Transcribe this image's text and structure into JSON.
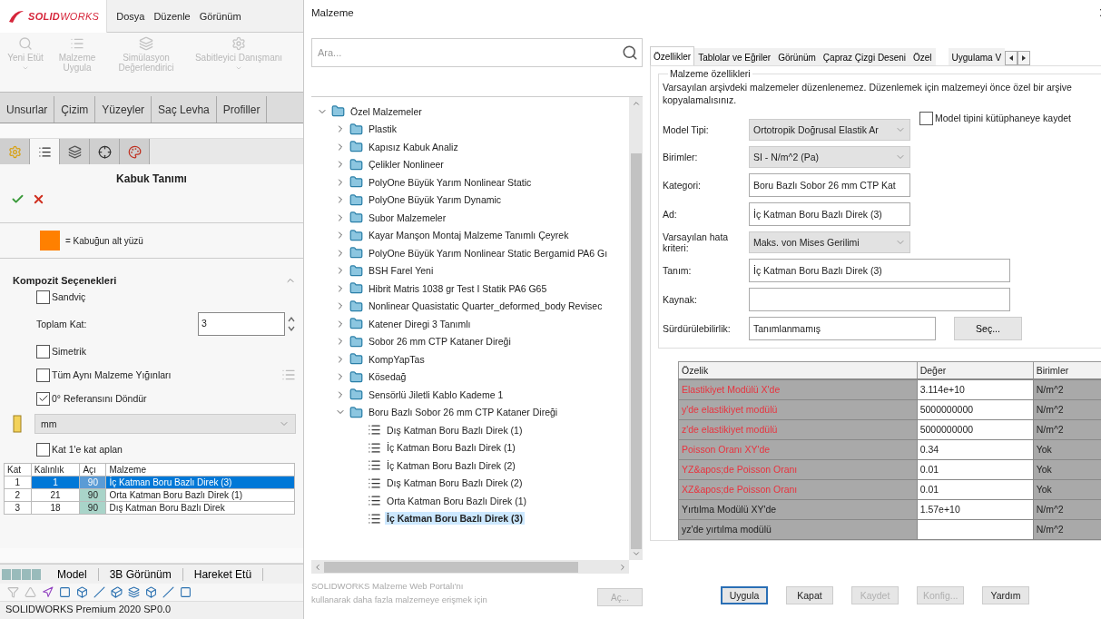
{
  "app": {
    "logo_text": "**SOLID**WORKS",
    "menu": [
      "Dosya",
      "Düzenle",
      "Görünüm"
    ],
    "ribbon": [
      {
        "label": "Yeni Etüt",
        "caret": true
      },
      {
        "label": "Malzeme Uygula",
        "caret": false
      },
      {
        "label": "Simülasyon Değerlendirici",
        "caret": false
      },
      {
        "label": "Sabitleyici Danışmanı",
        "caret": true
      }
    ],
    "command_tabs": [
      {
        "label": "Unsurlar",
        "selected": false
      },
      {
        "label": "Çizim",
        "selected": false
      },
      {
        "label": "Yüzeyler",
        "selected": false
      },
      {
        "label": "Saç Levha",
        "selected": false
      },
      {
        "label": "Profiller",
        "selected": false
      }
    ],
    "manager_tabs": [
      {
        "selected": false
      },
      {
        "selected": true
      },
      {
        "selected": false
      },
      {
        "selected": false
      },
      {
        "selected": false
      }
    ],
    "property_manager": {
      "title": "Kabuk Tanımı",
      "legend": "= Kabuğun alt yüzü",
      "section": {
        "title": "Kompozit Seçenekleri",
        "expanded": true,
        "options": [
          {
            "kind": "checkbox",
            "label": "Sandviç",
            "checked": false
          },
          {
            "kind": "spin",
            "label": "Toplam Kat:",
            "value": "3"
          },
          {
            "kind": "checkbox",
            "label": "Simetrik",
            "checked": false
          },
          {
            "kind": "checkbox",
            "label": "Tüm Aynı Malzeme Yığınları",
            "checked": false,
            "side_icon": true
          },
          {
            "kind": "checkbox",
            "label": "0° Referansını Döndür",
            "checked": true
          },
          {
            "kind": "select",
            "value": "mm"
          },
          {
            "kind": "checkbox",
            "label": "Kat 1'e kat aplan",
            "checked": false
          }
        ],
        "layers": {
          "columns": [
            "Kat",
            "Kalınlık",
            "Açı",
            "Malzeme"
          ],
          "rows": [
            {
              "cells": [
                "1",
                "1",
                "90",
                "İç Katman Boru Bazlı Direk (3)"
              ],
              "selected": true
            },
            {
              "cells": [
                "2",
                "21",
                "90",
                "Orta Katman Boru Bazlı Direk (1)"
              ],
              "selected": false
            },
            {
              "cells": [
                "3",
                "18",
                "90",
                "Dış Katman Boru Bazlı Direk"
              ],
              "selected": false
            }
          ]
        }
      }
    },
    "bottom_tabs": [
      "Model",
      "3B Görünüm",
      "Hareket Etü"
    ],
    "status_bar": "SOLIDWORKS Premium 2020 SP0.0"
  },
  "dialog": {
    "title": "Malzeme",
    "search": {
      "placeholder": "Ara..."
    },
    "tree": [
      {
        "kind": "folder",
        "label": "Özel Malzemeler",
        "expanded": true,
        "selected": false,
        "children": [
          {
            "kind": "folder",
            "label": "Plastik",
            "expanded": false,
            "selected": false
          },
          {
            "kind": "folder",
            "label": "Kapısız Kabuk Analiz",
            "expanded": false,
            "selected": false
          },
          {
            "kind": "folder",
            "label": "Çelikler Nonlineer",
            "expanded": false,
            "selected": false
          },
          {
            "kind": "folder",
            "label": "PolyOne Büyük Yarım Nonlinear Static",
            "expanded": false,
            "selected": false
          },
          {
            "kind": "folder",
            "label": "PolyOne Büyük Yarım Dynamic",
            "expanded": false,
            "selected": false
          },
          {
            "kind": "folder",
            "label": "Subor Malzemeler",
            "expanded": false,
            "selected": false
          },
          {
            "kind": "folder",
            "label": "Kayar Manşon Montaj Malzeme Tanımlı Çeyrek",
            "expanded": false,
            "selected": false
          },
          {
            "kind": "folder",
            "label": "PolyOne Büyük Yarım Nonlinear Static Bergamid PA6 Gı",
            "expanded": false,
            "selected": false
          },
          {
            "kind": "folder",
            "label": "BSH Farel Yeni",
            "expanded": false,
            "selected": false
          },
          {
            "kind": "folder",
            "label": "Hibrit Matris 1038 gr Test I Statik PA6 G65",
            "expanded": false,
            "selected": false
          },
          {
            "kind": "folder",
            "label": "Nonlinear Quasistatic Quarter_deformed_body Revisec",
            "expanded": false,
            "selected": false
          },
          {
            "kind": "folder",
            "label": "Katener Diregi 3 Tanımlı",
            "expanded": false,
            "selected": false
          },
          {
            "kind": "folder",
            "label": "Sobor 26 mm CTP Kataner Direği",
            "expanded": false,
            "selected": false
          },
          {
            "kind": "folder",
            "label": "KompYapTas",
            "expanded": false,
            "selected": false
          },
          {
            "kind": "folder",
            "label": "Kösedağ",
            "expanded": false,
            "selected": false
          },
          {
            "kind": "folder",
            "label": "Sensörlü Jiletli Kablo Kademe 1",
            "expanded": false,
            "selected": false
          },
          {
            "kind": "folder",
            "label": "Boru Bazlı Sobor 26 mm CTP Kataner Direği",
            "expanded": true,
            "selected": false,
            "children": [
              {
                "kind": "material",
                "label": "Dış Katman Boru Bazlı Direk (1)",
                "selected": false
              },
              {
                "kind": "material",
                "label": "İç Katman Boru Bazlı Direk (1)",
                "selected": false
              },
              {
                "kind": "material",
                "label": "İç Katman Boru Bazlı Direk (2)",
                "selected": false
              },
              {
                "kind": "material",
                "label": "Dış Katman Boru Bazlı Direk (2)",
                "selected": false
              },
              {
                "kind": "material",
                "label": "Orta Katman Boru Bazlı Direk (1)",
                "selected": false
              },
              {
                "kind": "material",
                "label": "İç Katman Boru Bazlı Direk (3)",
                "selected": true
              }
            ]
          }
        ]
      }
    ],
    "portal_text": "SOLIDWORKS Malzeme Web Portalı'nı kullanarak daha fazla malzemeye erişmek için",
    "open_button": {
      "label": "Aç...",
      "disabled": true
    },
    "tabs": [
      {
        "label": "Özellikler",
        "selected": true
      },
      {
        "label": "Tablolar ve Eğriler",
        "selected": false
      },
      {
        "label": "Görünüm",
        "selected": false
      },
      {
        "label": "Çapraz Çizgi Deseni",
        "selected": false
      },
      {
        "label": "Özel",
        "selected": false
      },
      {
        "label": "Uygulama V",
        "selected": false
      }
    ],
    "group_title": "Malzeme özellikleri",
    "note": "Varsayılan arşivdeki malzemeler düzenlenemez. Düzenlemek için malzemeyi önce özel bir arşive kopyalamalısınız.",
    "save_model_type": {
      "label": "Model tipini kütüphaneye kaydet",
      "checked": false
    },
    "fields": [
      {
        "kind": "select",
        "label": "Model Tipi:",
        "value": "Ortotropik Doğrusal Elastik Ar"
      },
      {
        "kind": "select",
        "label": "Birimler:",
        "value": "SI - N/m^2 (Pa)"
      },
      {
        "kind": "input",
        "label": "Kategori:",
        "value": "Boru Bazlı Sobor 26 mm CTP Kat"
      },
      {
        "kind": "input",
        "label": "Ad:",
        "value": "İç Katman Boru Bazlı Direk (3)"
      },
      {
        "kind": "select",
        "label": "Varsayılan hata kriteri:",
        "value": "Maks. von Mises Gerilimi"
      },
      {
        "kind": "wide",
        "label": "Tanım:",
        "value": "İç Katman Boru Bazlı Direk (3)"
      },
      {
        "kind": "wide",
        "label": "Kaynak:"
      },
      {
        "kind": "button_input",
        "label": "Sürdürülebilirlik:",
        "value": "Tanımlanmamış",
        "button": "Seç..."
      }
    ],
    "properties": {
      "columns": [
        "Özelik",
        "Değer",
        "Birimler"
      ],
      "rows": [
        {
          "name": "Elastikiyet Modülü X'de",
          "value": "3.114e+10",
          "unit": "N/m^2",
          "required": true
        },
        {
          "name": "y'de elastikiyet modülü",
          "value": "5000000000",
          "unit": "N/m^2",
          "required": true
        },
        {
          "name": "z'de elastikiyet modülü",
          "value": "5000000000",
          "unit": "N/m^2",
          "required": true
        },
        {
          "name": "Poisson Oranı XY'de",
          "value": "0.34",
          "unit": "Yok",
          "required": true
        },
        {
          "name": "YZ&apos;de Poisson Oranı",
          "value": "0.01",
          "unit": "Yok",
          "required": true
        },
        {
          "name": "XZ&apos;de Poisson Oranı",
          "value": "0.01",
          "unit": "Yok",
          "required": true
        },
        {
          "name": "Yırtılma Modülü XY'de",
          "value": "1.57e+10",
          "unit": "N/m^2",
          "required": false
        },
        {
          "name": "yz'de yırtılma modülü",
          "unit": "N/m^2",
          "required": false
        }
      ]
    },
    "buttons": [
      {
        "label": "Uygula",
        "disabled": false,
        "default": true
      },
      {
        "label": "Kapat",
        "disabled": false,
        "default": false
      },
      {
        "label": "Kaydet",
        "disabled": true,
        "default": false
      },
      {
        "label": "Konfig...",
        "disabled": true,
        "default": false
      },
      {
        "label": "Yardım",
        "disabled": false,
        "default": false
      }
    ]
  }
}
